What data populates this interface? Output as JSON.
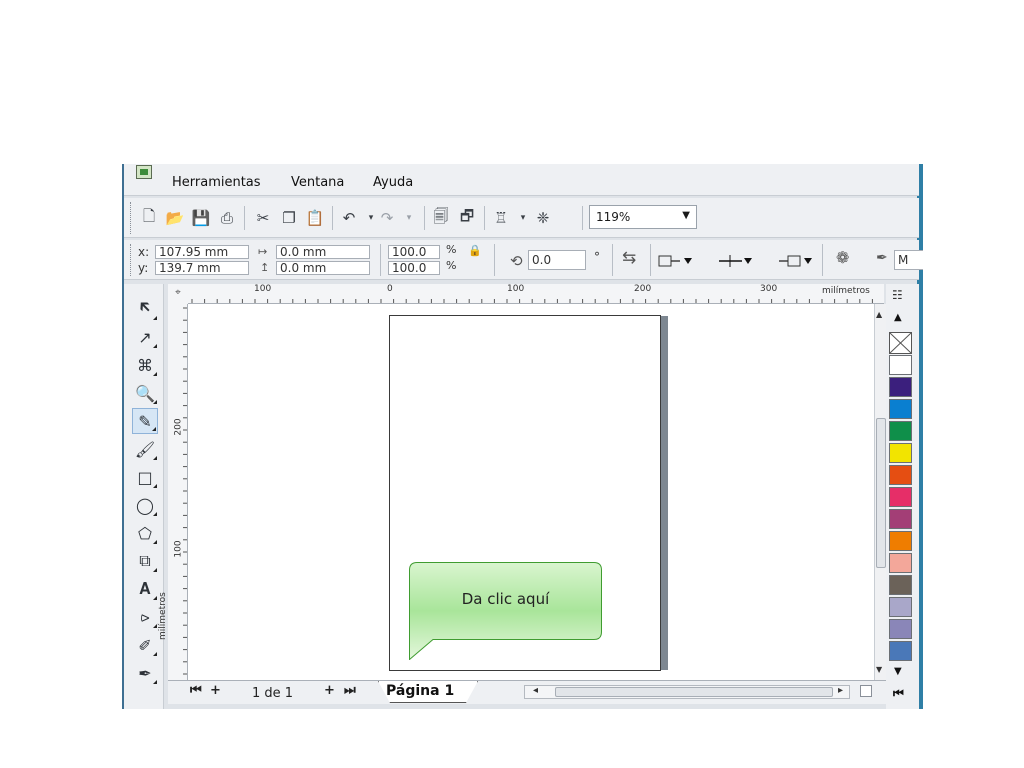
{
  "menu": {
    "tools": "Herramientas",
    "window": "Ventana",
    "help": "Ayuda"
  },
  "toolbar": {
    "zoom": "119%"
  },
  "propbar": {
    "x_label": "x:",
    "y_label": "y:",
    "x_value": "107.95 mm",
    "y_value": "139.7 mm",
    "w_value": "0.0 mm",
    "h_value": "0.0 mm",
    "scale_x": "100.0",
    "scale_y": "100.0",
    "percent": "%",
    "angle": "0.0",
    "degree": "°",
    "font_initial": "M"
  },
  "rulers": {
    "h_ticks": [
      "100",
      "0",
      "100",
      "200",
      "300"
    ],
    "h_unit": "milímetros",
    "v_ticks": [
      "200",
      "100"
    ],
    "v_unit": "milímetros"
  },
  "canvas": {
    "callout_text": "Da clic aquí"
  },
  "palette": {
    "colors": [
      "#ffffff",
      "#3b1f7d",
      "#0a7fd0",
      "#0f8f4a",
      "#f2e400",
      "#e54e12",
      "#e62e68",
      "#a33e76",
      "#ef7d00",
      "#f3a79a",
      "#6b6259",
      "#a9a7c9",
      "#8a86b8",
      "#4a78b8"
    ]
  },
  "bottombar": {
    "page_count": "1 de 1",
    "page_tab": "Página 1"
  }
}
